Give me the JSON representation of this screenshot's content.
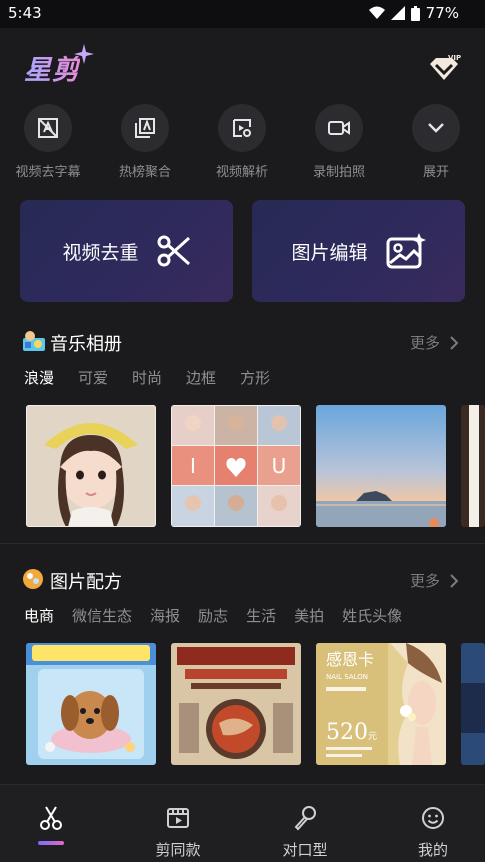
{
  "status": {
    "time": "5:43",
    "battery": "77%"
  },
  "app": {
    "logo": "星剪",
    "vip_icon": "vip-diamond-icon"
  },
  "tools": [
    {
      "label": "视频去字幕",
      "icon": "remove-subtitle-icon"
    },
    {
      "label": "热榜聚合",
      "icon": "trending-icon"
    },
    {
      "label": "视频解析",
      "icon": "video-parse-icon"
    },
    {
      "label": "录制拍照",
      "icon": "camera-record-icon"
    },
    {
      "label": "展开",
      "icon": "chevron-down-icon"
    }
  ],
  "big_buttons": [
    {
      "label": "视频去重",
      "icon": "scissors-icon"
    },
    {
      "label": "图片编辑",
      "icon": "image-edit-icon"
    }
  ],
  "music_album": {
    "title": "音乐相册",
    "more": "更多",
    "categories": [
      "浪漫",
      "可爱",
      "时尚",
      "边框",
      "方形"
    ],
    "grid_letters": [
      "I",
      "U"
    ]
  },
  "image_recipe": {
    "title": "图片配方",
    "more": "更多",
    "categories": [
      "电商",
      "微信生态",
      "海报",
      "励志",
      "生活",
      "美拍",
      "姓氏头像"
    ],
    "nail_card": {
      "title": "感恩卡",
      "subtitle": "NAIL SALON",
      "price": "520",
      "unit": "元"
    }
  },
  "tabbar": [
    {
      "label": "",
      "icon": "scissors-tab-icon"
    },
    {
      "label": "剪同款",
      "icon": "template-film-icon"
    },
    {
      "label": "对口型",
      "icon": "microphone-icon"
    },
    {
      "label": "我的",
      "icon": "smile-face-icon"
    }
  ]
}
